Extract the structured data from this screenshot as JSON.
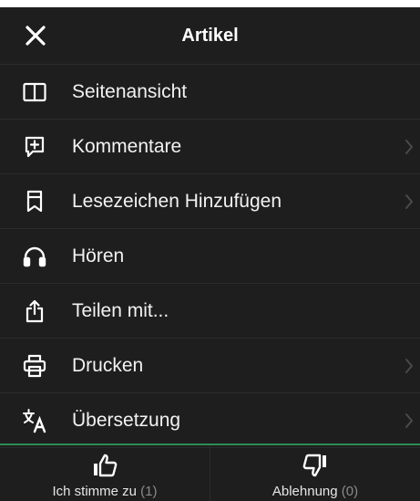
{
  "header": {
    "title": "Artikel"
  },
  "menu": [
    {
      "label": "Seitenansicht",
      "icon": "split-view-icon",
      "chevron": false
    },
    {
      "label": "Kommentare",
      "icon": "comment-add-icon",
      "chevron": true
    },
    {
      "label": "Lesezeichen Hinzufügen",
      "icon": "bookmark-icon",
      "chevron": true
    },
    {
      "label": "Hören",
      "icon": "headphones-icon",
      "chevron": false
    },
    {
      "label": "Teilen mit...",
      "icon": "share-icon",
      "chevron": false
    },
    {
      "label": "Drucken",
      "icon": "print-icon",
      "chevron": true
    },
    {
      "label": "Übersetzung",
      "icon": "translate-icon",
      "chevron": true
    }
  ],
  "footer": {
    "agree": {
      "label": "Ich stimme zu",
      "count": "(1)"
    },
    "reject": {
      "label": "Ablehnung",
      "count": "(0)"
    }
  },
  "colors": {
    "background": "#1e1e1e",
    "divider": "#2c2c2c",
    "accent": "#2e8b57"
  }
}
